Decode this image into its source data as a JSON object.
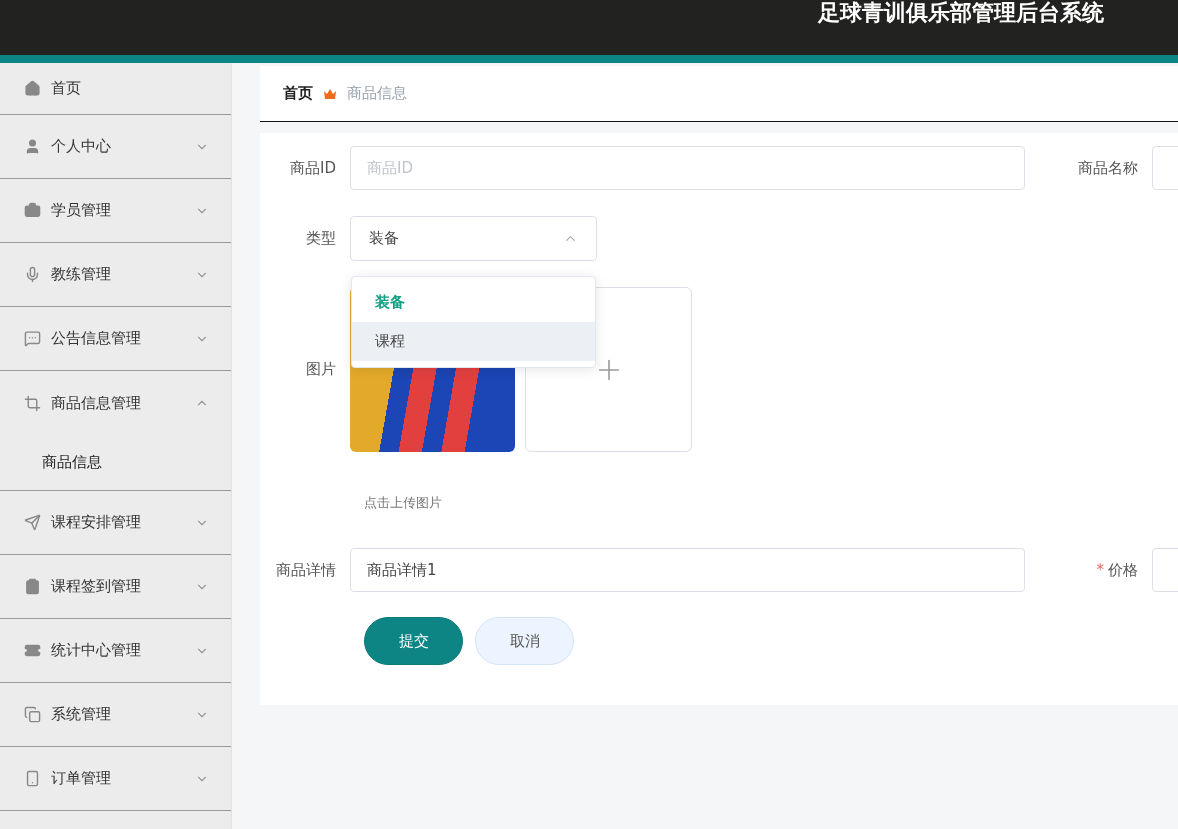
{
  "header": {
    "title": "足球青训俱乐部管理后台系统"
  },
  "sidebar": {
    "items": [
      {
        "label": "首页",
        "kind": "link"
      },
      {
        "label": "个人中心",
        "kind": "menu",
        "expanded": false
      },
      {
        "label": "学员管理",
        "kind": "menu",
        "expanded": false
      },
      {
        "label": "教练管理",
        "kind": "menu",
        "expanded": false
      },
      {
        "label": "公告信息管理",
        "kind": "menu",
        "expanded": false
      },
      {
        "label": "商品信息管理",
        "kind": "menu",
        "expanded": true,
        "children": [
          {
            "label": "商品信息"
          }
        ]
      },
      {
        "label": "课程安排管理",
        "kind": "menu",
        "expanded": false
      },
      {
        "label": "课程签到管理",
        "kind": "menu",
        "expanded": false
      },
      {
        "label": "统计中心管理",
        "kind": "menu",
        "expanded": false
      },
      {
        "label": "系统管理",
        "kind": "menu",
        "expanded": false
      },
      {
        "label": "订单管理",
        "kind": "menu",
        "expanded": false
      }
    ]
  },
  "breadcrumb": [
    {
      "label": "首页"
    },
    {
      "label": "商品信息"
    }
  ],
  "form": {
    "product_id": {
      "label": "商品ID",
      "placeholder": "商品ID"
    },
    "product_name": {
      "label": "商品名称"
    },
    "type": {
      "label": "类型",
      "value": "装备",
      "expanded": true,
      "options": [
        {
          "label": "装备",
          "selected": true,
          "hovered": false
        },
        {
          "label": "课程",
          "selected": false,
          "hovered": true
        }
      ]
    },
    "image": {
      "label": "图片",
      "hint": "点击上传图片"
    },
    "details": {
      "label": "商品详情",
      "value": "商品详情1"
    },
    "price": {
      "label": "价格",
      "required_mark": "*"
    },
    "buttons": [
      {
        "label": "提交",
        "kind": "primary"
      },
      {
        "label": "取消",
        "kind": "secondary"
      }
    ]
  }
}
